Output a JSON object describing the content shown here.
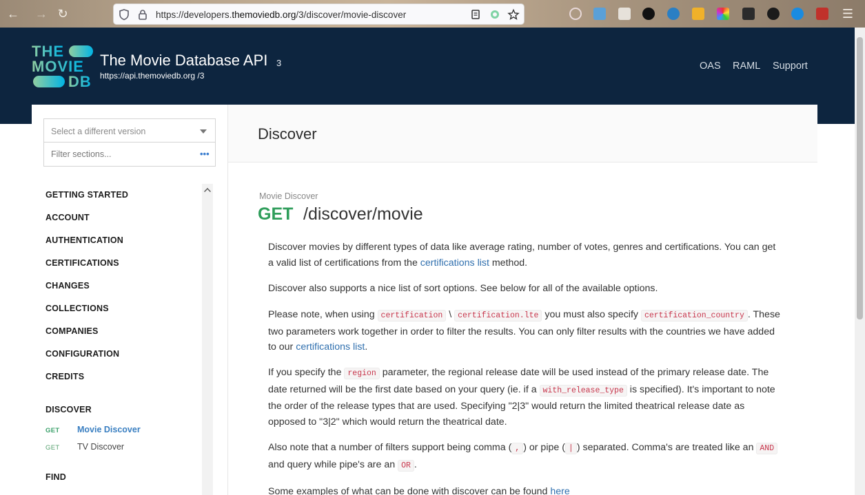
{
  "browser": {
    "url_prefix": "https://developers.",
    "url_domain": "themoviedb.org",
    "url_path": "/3/discover/movie-discover"
  },
  "header": {
    "logo": [
      "THE",
      "MOVIE",
      "DB"
    ],
    "title": "The Movie Database API",
    "version": "3",
    "base_url": "https://api.themoviedb.org /3",
    "nav": [
      "OAS",
      "RAML",
      "Support"
    ]
  },
  "sidebar": {
    "version_select_placeholder": "Select a different version",
    "filter_placeholder": "Filter sections...",
    "filter_menu": "•••",
    "sections": [
      "GETTING STARTED",
      "ACCOUNT",
      "AUTHENTICATION",
      "CERTIFICATIONS",
      "CHANGES",
      "COLLECTIONS",
      "COMPANIES",
      "CONFIGURATION",
      "CREDITS",
      "DISCOVER",
      "FIND"
    ],
    "discover_items": [
      {
        "verb": "GET",
        "label": "Movie Discover"
      },
      {
        "verb": "GET",
        "label": "TV Discover"
      }
    ]
  },
  "main": {
    "title": "Discover",
    "endpoint": {
      "label": "Movie Discover",
      "method": "GET",
      "path": "/discover/movie"
    },
    "p1": {
      "a": "Discover movies by different types of data like average rating, number of votes, genres and certifications. You can get a valid list of certifications from the ",
      "link": "certifications list",
      "b": " method."
    },
    "p2": "Discover also supports a nice list of sort options. See below for all of the available options.",
    "p3": {
      "a": "Please note, when using ",
      "code1": "certification",
      "sep": " \\ ",
      "code2": "certification.lte",
      "b": " you must also specify ",
      "code3": "certification_country",
      "c": ". These two parameters work together in order to filter the results. You can only filter results with the countries we have added to our ",
      "link": "certifications list",
      "d": "."
    },
    "p4": {
      "a": "If you specify the ",
      "code1": "region",
      "b": " parameter, the regional release date will be used instead of the primary release date. The date returned will be the first date based on your query (ie. if a ",
      "code2": "with_release_type",
      "c": " is specified). It's important to note the order of the release types that are used. Specifying \"2|3\" would return the limited theatrical release date as opposed to \"3|2\" which would return the theatrical date."
    },
    "p5": {
      "a": "Also note that a number of filters support being comma (",
      "code1": ",",
      "b": ") or pipe (",
      "code2": "|",
      "c": ") separated. Comma's are treated like an ",
      "code3": "AND",
      "d": " and query while pipe's are an ",
      "code4": "OR",
      "e": "."
    },
    "p6": {
      "a": "Some examples of what can be done with discover can be found ",
      "link": "here"
    }
  }
}
